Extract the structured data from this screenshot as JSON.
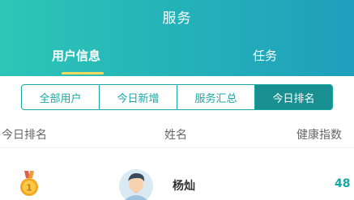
{
  "header": {
    "title": "服务"
  },
  "tabs": [
    {
      "label": "用户信息",
      "active": true
    },
    {
      "label": "任务",
      "active": false
    }
  ],
  "segments": [
    {
      "label": "全部用户",
      "active": false
    },
    {
      "label": "今日新增",
      "active": false
    },
    {
      "label": "服务汇总",
      "active": false
    },
    {
      "label": "今日排名",
      "active": true
    }
  ],
  "table": {
    "headers": {
      "rank": "今日排名",
      "name": "姓名",
      "health": "健康指数"
    },
    "rows": [
      {
        "rank": 1,
        "medal_label": "1",
        "name": "杨灿",
        "score": "48"
      }
    ]
  },
  "colors": {
    "header_gradient_start": "#2cc6b6",
    "header_gradient_end": "#1f9fbc",
    "accent": "#1aa7a4",
    "active_segment": "#1a8f92",
    "tab_underline": "#ffd75e"
  }
}
